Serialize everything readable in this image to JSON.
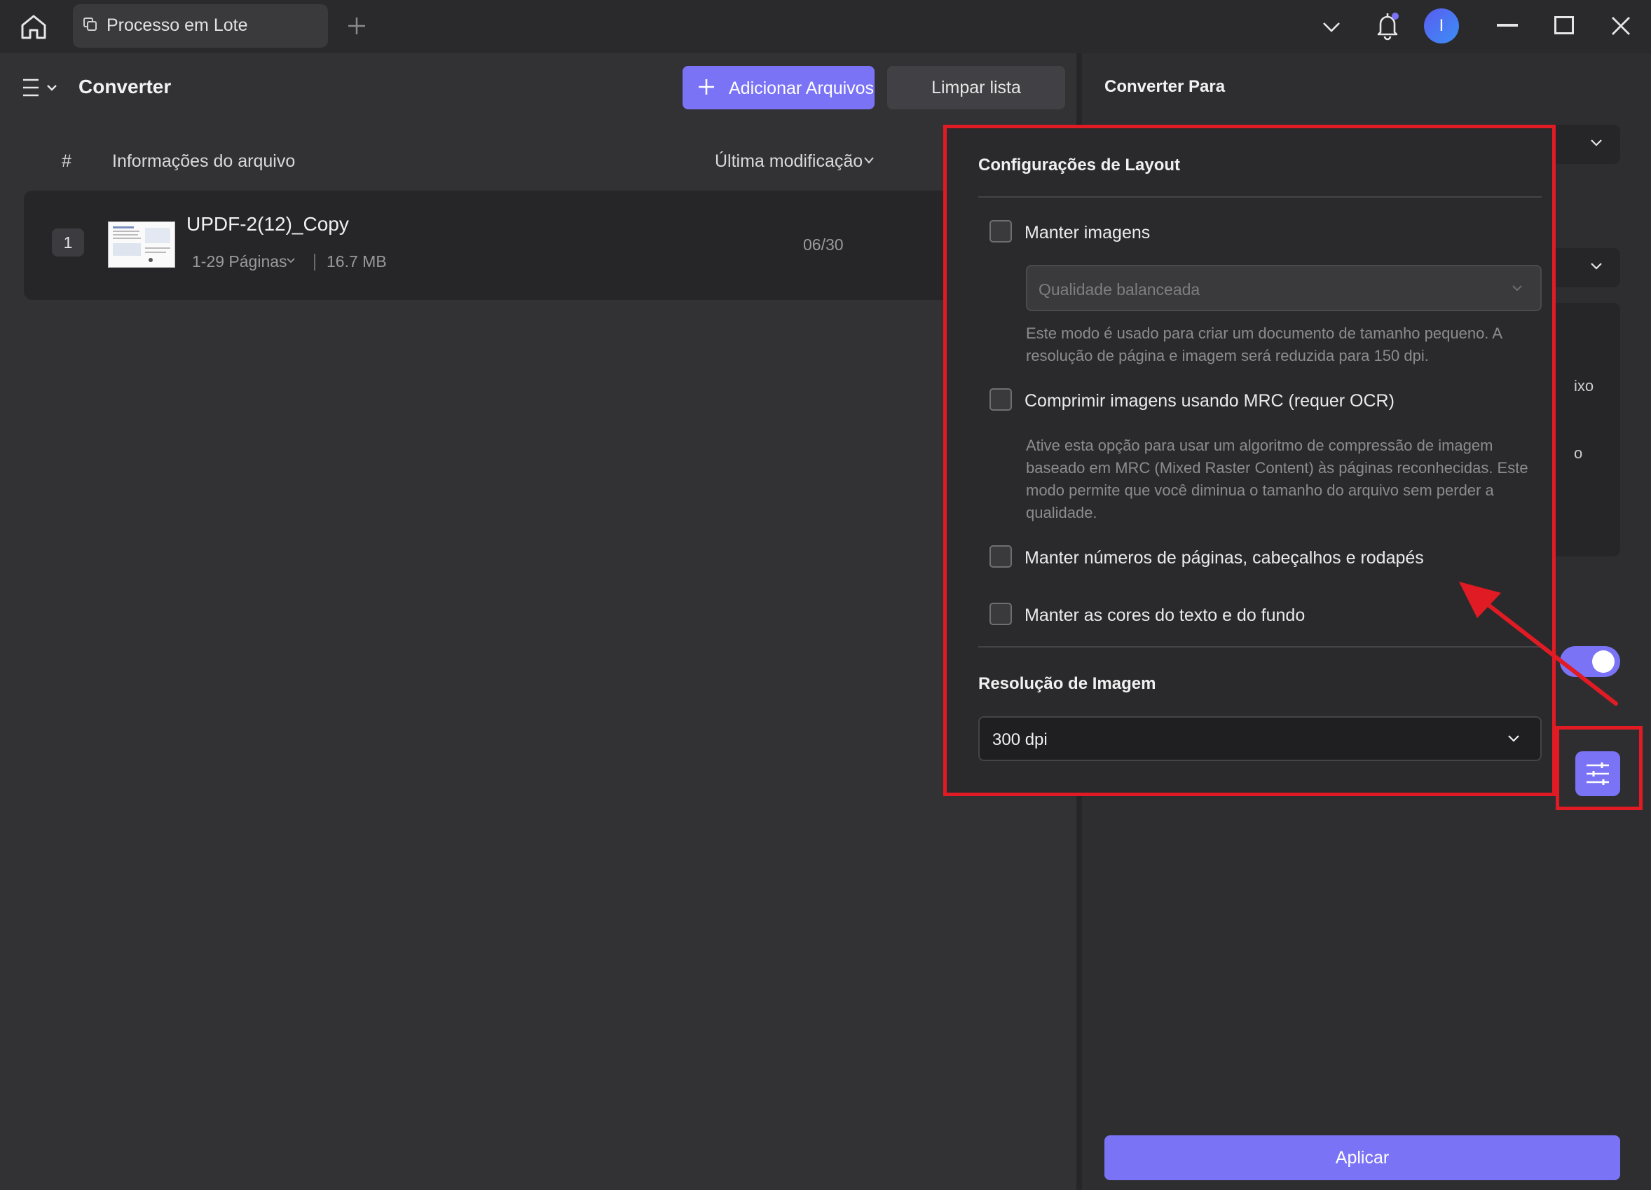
{
  "titlebar": {
    "tab_label": "Processo em Lote",
    "avatar_letter": "I"
  },
  "left": {
    "title": "Converter",
    "add_files_label": "Adicionar Arquivos",
    "clear_list_label": "Limpar lista",
    "columns": {
      "index": "#",
      "file_info": "Informações do arquivo",
      "last_modified": "Última modificação"
    },
    "files": [
      {
        "index": "1",
        "name": "UPDF-2(12)_Copy",
        "pages": "1-29 Páginas",
        "size": "16.7 MB",
        "date": "06/30"
      }
    ]
  },
  "right": {
    "title": "Converter Para",
    "partial_text_1": "ixo",
    "partial_text_2": "o",
    "apply_label": "Aplicar",
    "toggle_on": true
  },
  "popup": {
    "title": "Configurações de Layout",
    "keep_images_label": "Manter imagens",
    "quality_placeholder": "Qualidade balanceada",
    "quality_desc": "Este modo é usado para criar um documento de tamanho pequeno. A resolução de página e imagem será reduzida para 150 dpi.",
    "mrc_label": "Comprimir imagens usando MRC (requer OCR)",
    "mrc_desc": "Ative esta opção para usar um algoritmo de compressão de imagem baseado em MRC (Mixed Raster Content) às páginas reconhecidas. Este modo permite que você diminua o tamanho do arquivo sem perder a qualidade.",
    "page_numbers_label": "Manter números de páginas, cabeçalhos e rodapés",
    "colors_label": "Manter as cores do texto e do fundo",
    "resolution_title": "Resolução de Imagem",
    "resolution_value": "300 dpi"
  },
  "colors": {
    "accent": "#7b73f5",
    "annotation": "#e01b24",
    "background": "#323235"
  }
}
